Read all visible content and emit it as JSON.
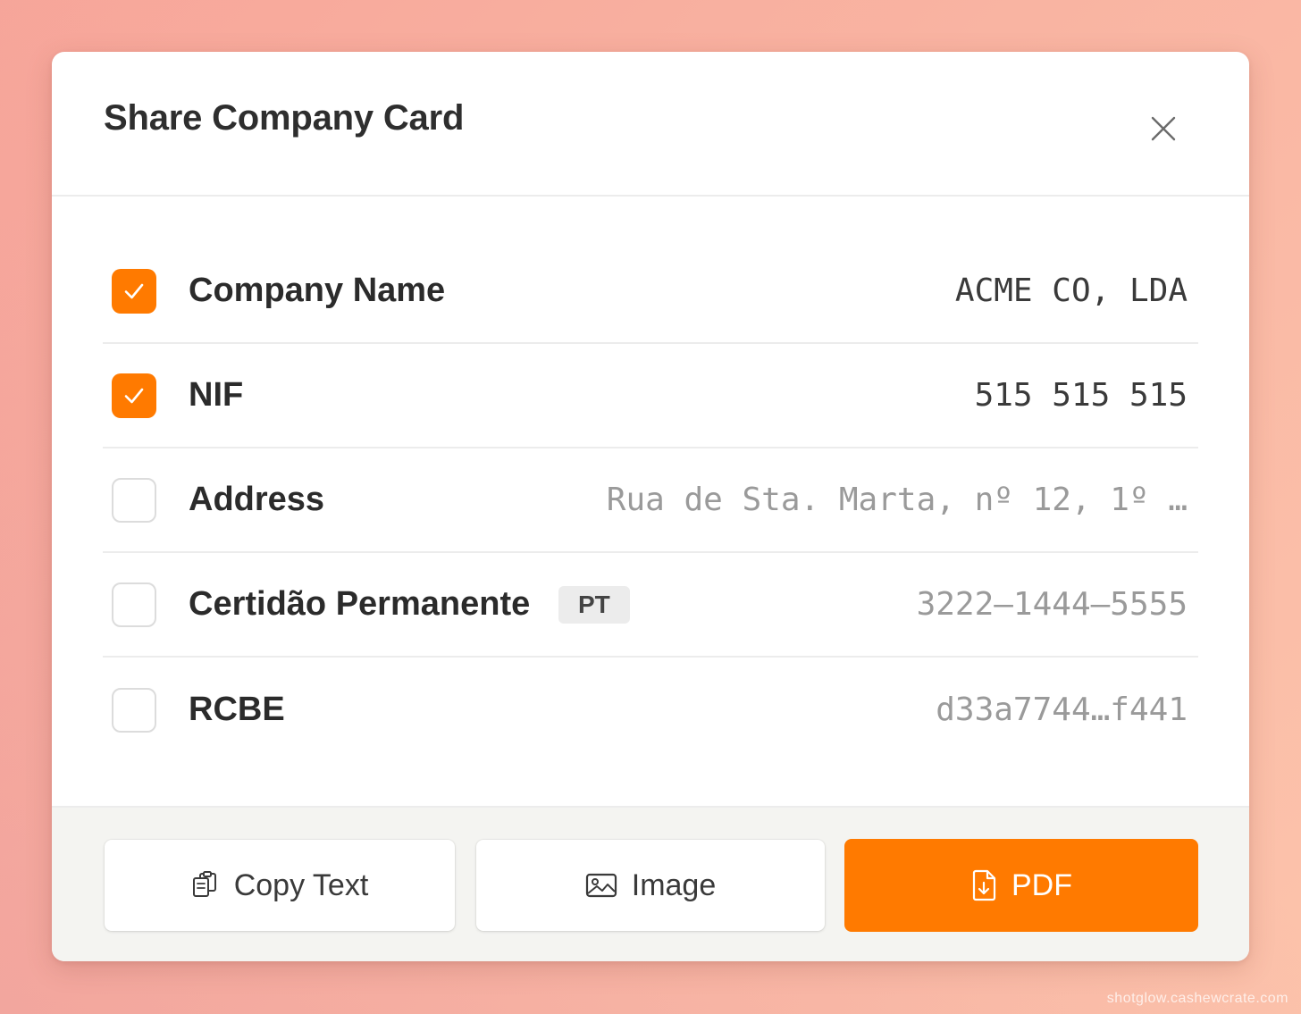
{
  "dialog": {
    "title": "Share Company Card"
  },
  "fields": [
    {
      "label": "Company Name",
      "value": "ACME CO, LDA",
      "checked": true
    },
    {
      "label": "NIF",
      "value": "515 515 515",
      "checked": true
    },
    {
      "label": "Address",
      "value": "Rua de Sta. Marta, nº 12, 1º …",
      "checked": false
    },
    {
      "label": "Certidão Permanente",
      "badge": "PT",
      "value": "3222–1444–5555",
      "checked": false
    },
    {
      "label": "RCBE",
      "value": "d33a7744…f441",
      "checked": false
    }
  ],
  "actions": {
    "copy_label": "Copy Text",
    "image_label": "Image",
    "pdf_label": "PDF"
  },
  "icons": {
    "close": "close-icon",
    "check": "checkmark-icon",
    "copy": "clipboard-copy-icon",
    "image": "image-icon",
    "pdf": "file-download-icon"
  },
  "colors": {
    "accent": "#ff7a00",
    "title_text": "#2e2e2e",
    "muted_value": "#9a9a9a"
  },
  "watermark": "shotglow.cashewcrate.com"
}
